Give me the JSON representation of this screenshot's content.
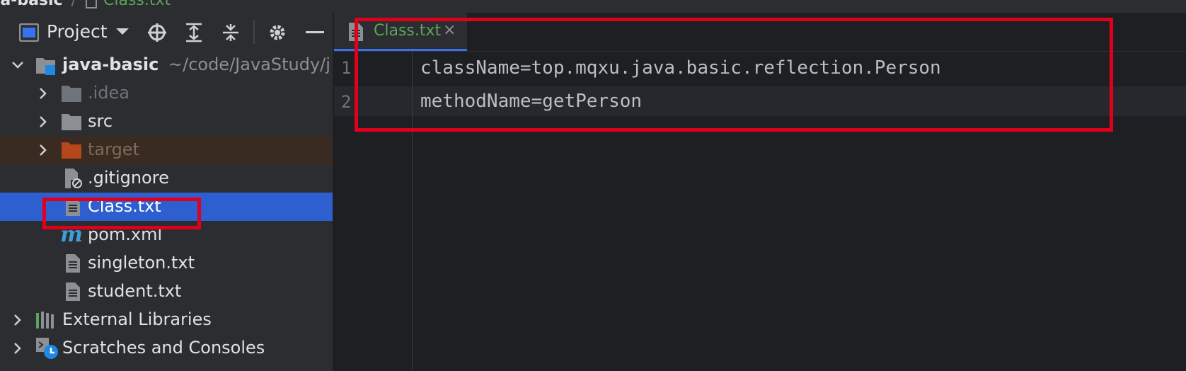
{
  "breadcrumb": {
    "project": "va-basic",
    "separator": "/",
    "file": "Class.txt"
  },
  "toolbar": {
    "project_label": "Project",
    "icons": [
      "project-view-icon",
      "chevron-down-icon",
      "locate-icon",
      "expand-all-icon",
      "collapse-all-icon",
      "gear-icon",
      "minimize-icon"
    ]
  },
  "tree": {
    "root": {
      "name": "java-basic",
      "path": "~/code/JavaStudy/j"
    },
    "items": [
      {
        "label": ".idea",
        "kind": "folder",
        "state": "muted"
      },
      {
        "label": "src",
        "kind": "folder",
        "state": "normal"
      },
      {
        "label": "target",
        "kind": "folder",
        "state": "excluded"
      },
      {
        "label": ".gitignore",
        "kind": "ignore-file",
        "state": "normal"
      },
      {
        "label": "Class.txt",
        "kind": "text-file",
        "state": "selected"
      },
      {
        "label": "pom.xml",
        "kind": "maven-file",
        "state": "normal"
      },
      {
        "label": "singleton.txt",
        "kind": "text-file",
        "state": "normal"
      },
      {
        "label": "student.txt",
        "kind": "text-file",
        "state": "normal"
      }
    ],
    "external_libraries": "External Libraries",
    "scratches": "Scratches and Consoles"
  },
  "editor": {
    "tab_label": "Class.txt",
    "tab_close": "×",
    "lines": [
      {
        "number": "1",
        "text": "className=top.mqxu.java.basic.reflection.Person"
      },
      {
        "number": "2",
        "text": "methodName=getPerson"
      }
    ]
  },
  "colors": {
    "selection": "#2e5fd1",
    "highlight_box": "#e0001b",
    "tab_text": "#5ea35b",
    "excluded_folder": "#b5471a"
  }
}
